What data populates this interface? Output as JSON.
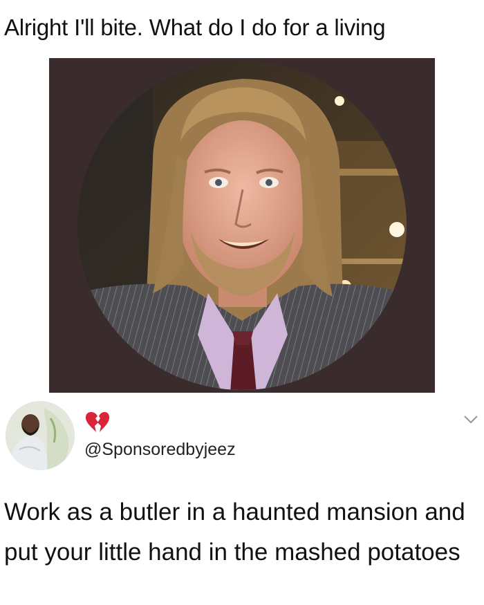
{
  "post": {
    "caption": "Alright I'll bite. What do I do for a living"
  },
  "photo": {
    "icon": "circular-portrait-photo",
    "frame_color": "#3a2c2c"
  },
  "reply": {
    "avatar_icon": "user-avatar-photo",
    "emoji_icon": "broken-heart-icon",
    "handle": "@Sponsoredbyjeez",
    "text": "Work as a butler in a haunted mansion and put your little hand in the mashed potatoes",
    "menu_icon": "chevron-down-icon"
  }
}
